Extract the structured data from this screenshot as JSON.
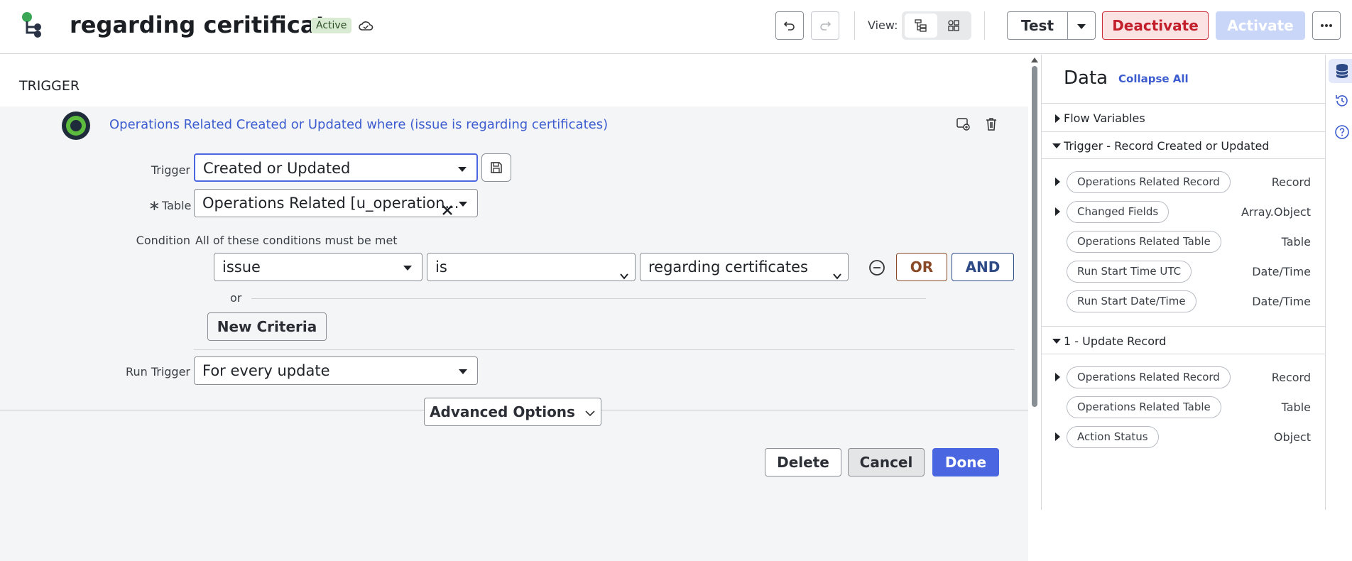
{
  "header": {
    "title": "regarding ceritificate",
    "status": "Active",
    "view_label": "View:",
    "test_label": "Test",
    "deactivate_label": "Deactivate",
    "activate_label": "Activate"
  },
  "trigger": {
    "section_title": "TRIGGER",
    "summary": "Operations Related Created or Updated where (issue is regarding certificates)",
    "trigger_label": "Trigger",
    "trigger_value": "Created or Updated",
    "table_label": "Table",
    "table_required_mark": "∗",
    "table_value": "Operations Related [u_operation...",
    "condition_label": "Condition",
    "condition_desc": "All of these conditions must be met",
    "condition_row": {
      "field": "issue",
      "operator": "is",
      "value": "regarding certificates",
      "operator_options": [
        "is"
      ],
      "value_options": [
        "regarding certificates"
      ]
    },
    "or_btn": "OR",
    "and_btn": "AND",
    "or_separator": "or",
    "new_criteria": "New Criteria",
    "run_trigger_label": "Run Trigger",
    "run_trigger_value": "For every update",
    "advanced_options": "Advanced Options",
    "delete_btn": "Delete",
    "cancel_btn": "Cancel",
    "done_btn": "Done"
  },
  "data_panel": {
    "title": "Data",
    "collapse_all": "Collapse All",
    "flow_variables": "Flow Variables",
    "trigger_section": "Trigger - Record Created or Updated",
    "trigger_items": [
      {
        "name": "Operations Related Record",
        "type": "Record"
      },
      {
        "name": "Changed Fields",
        "type": "Array.Object"
      },
      {
        "name": "Operations Related Table",
        "type": "Table"
      },
      {
        "name": "Run Start Time UTC",
        "type": "Date/Time"
      },
      {
        "name": "Run Start Date/Time",
        "type": "Date/Time"
      }
    ],
    "update_section": "1 - Update Record",
    "update_items": [
      {
        "name": "Operations Related Record",
        "type": "Record"
      },
      {
        "name": "Operations Related Table",
        "type": "Table"
      },
      {
        "name": "Action Status",
        "type": "Object"
      }
    ]
  },
  "colors": {
    "accent_blue": "#4a66e0",
    "link_blue": "#3c5ccf",
    "deactivate_bg": "#fbe3e4",
    "deactivate_border": "#c8303a",
    "activate_bg": "#c9d6f7",
    "or_color": "#8a4a28",
    "and_color": "#2d4a87",
    "badge_bg": "#d9ecd3"
  },
  "icons": [
    "flow-logo-icon",
    "cloud-icon",
    "undo-icon",
    "redo-icon",
    "tree-view-icon",
    "grid-view-icon",
    "chevron-down-icon",
    "more-icon",
    "trigger-node-icon",
    "edit-comment-icon",
    "trash-icon",
    "save-icon",
    "clear-icon",
    "minus-circle-icon",
    "database-icon",
    "history-icon",
    "help-icon"
  ]
}
